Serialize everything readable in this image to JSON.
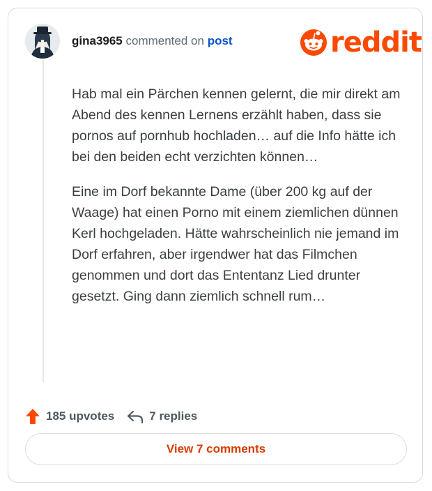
{
  "header": {
    "username": "gina3965",
    "commented_on_text": "commented on",
    "post_link": "post"
  },
  "logo": {
    "text": "reddit",
    "icon": "reddit-snoo-icon",
    "color": "#fc4900"
  },
  "comment": {
    "paragraphs": [
      "Hab mal ein Pärchen kennen gelernt, die mir direkt am Abend des kennen Lernens erzählt haben, dass sie pornos auf pornhub hochladen… auf die Info hätte ich bei den beiden echt verzichten können…",
      "Eine im Dorf bekannte Dame (über 200 kg auf der Waage) hat einen Porno mit einem ziemlichen dünnen Kerl hochgeladen. Hätte wahrscheinlich nie jemand im Dorf erfahren, aber irgendwer hat das Filmchen genommen und dort das Ententanz Lied drunter gesetzt. Ging dann ziemlich schnell rum…"
    ]
  },
  "actions": {
    "upvotes_label": "185 upvotes",
    "replies_label": "7 replies",
    "upvote_icon": "upvote-arrow-icon",
    "reply_icon": "reply-arrow-icon",
    "upvote_color": "#fc4900"
  },
  "view_button": {
    "label": "View 7 comments",
    "color": "#d93a00"
  }
}
